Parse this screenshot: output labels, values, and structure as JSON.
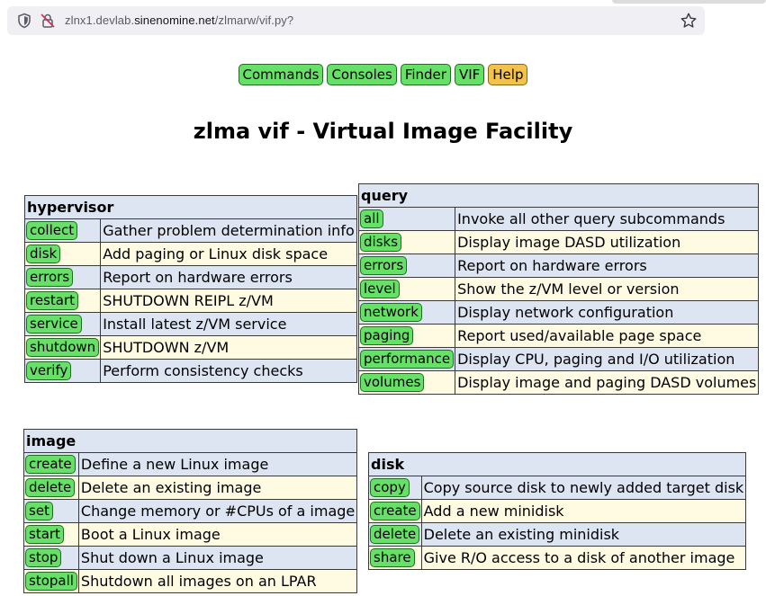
{
  "browser": {
    "url_prefix": "zlnx1.devlab.",
    "url_host": "sinenomine.net",
    "url_path": "/zlmarw/vif.py?"
  },
  "nav": [
    "Commands",
    "Consoles",
    "Finder",
    "VIF",
    "Help"
  ],
  "title": "zlma vif - Virtual Image Facility",
  "hypervisor": {
    "heading": "hypervisor",
    "rows": [
      {
        "cmd": "collect",
        "desc": "Gather problem determination info"
      },
      {
        "cmd": "disk",
        "desc": "Add paging or Linux disk space"
      },
      {
        "cmd": "errors",
        "desc": "Report on hardware errors"
      },
      {
        "cmd": "restart",
        "desc": "SHUTDOWN REIPL z/VM"
      },
      {
        "cmd": "service",
        "desc": "Install latest z/VM service"
      },
      {
        "cmd": "shutdown",
        "desc": "SHUTDOWN z/VM"
      },
      {
        "cmd": "verify",
        "desc": "Perform consistency checks"
      }
    ]
  },
  "query": {
    "heading": "query",
    "rows": [
      {
        "cmd": "all",
        "desc": "Invoke all other query subcommands"
      },
      {
        "cmd": "disks",
        "desc": "Display image DASD utilization"
      },
      {
        "cmd": "errors",
        "desc": "Report on hardware errors"
      },
      {
        "cmd": "level",
        "desc": "Show the z/VM level or version"
      },
      {
        "cmd": "network",
        "desc": "Display network configuration"
      },
      {
        "cmd": "paging",
        "desc": "Report used/available page space"
      },
      {
        "cmd": "performance",
        "desc": "Display CPU, paging and I/O utilization"
      },
      {
        "cmd": "volumes",
        "desc": "Display image and paging DASD volumes"
      }
    ]
  },
  "image": {
    "heading": "image",
    "rows": [
      {
        "cmd": "create",
        "desc": "Define a new Linux image"
      },
      {
        "cmd": "delete",
        "desc": "Delete an existing image"
      },
      {
        "cmd": "set",
        "desc": "Change memory or #CPUs of a image"
      },
      {
        "cmd": "start",
        "desc": "Boot a Linux image"
      },
      {
        "cmd": "stop",
        "desc": "Shut down a Linux image"
      },
      {
        "cmd": "stopall",
        "desc": "Shutdown all images on an LPAR"
      }
    ]
  },
  "disk": {
    "heading": "disk",
    "rows": [
      {
        "cmd": "copy",
        "desc": "Copy source disk to newly added target disk"
      },
      {
        "cmd": "create",
        "desc": "Add a new minidisk"
      },
      {
        "cmd": "delete",
        "desc": "Delete an existing minidisk"
      },
      {
        "cmd": "share",
        "desc": "Give R/O access to a disk of another image"
      }
    ]
  }
}
